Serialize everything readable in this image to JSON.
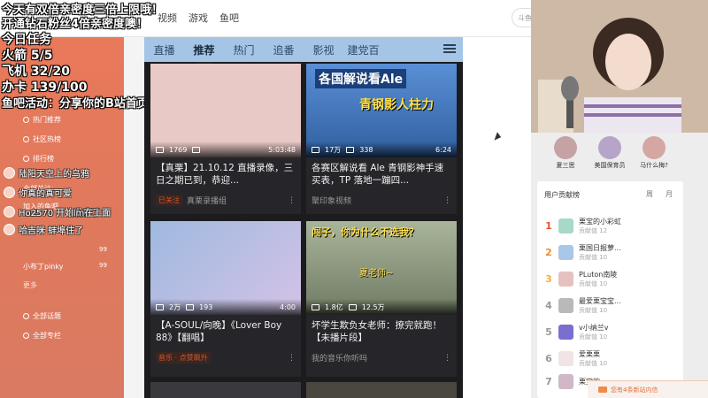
{
  "nav": {
    "items": [
      "视频",
      "游戏",
      "鱼吧"
    ],
    "search_placeholder": "斗鱼"
  },
  "sidebar": {
    "items": [
      {
        "label": "热门推荐"
      },
      {
        "label": "社区热榜"
      },
      {
        "label": "排行榜"
      },
      {
        "label": "全部关注"
      },
      {
        "label": "加入的鱼吧"
      },
      {
        "label": "小布丁pinky",
        "count": "99"
      },
      {
        "label": "更多"
      },
      {
        "label": "全部话题"
      },
      {
        "label": "全部专栏"
      }
    ],
    "counts": [
      "99"
    ]
  },
  "overlay": {
    "line1": "今天有双倍亲密度三倍上限哦！",
    "line2": "开通钻石粉丝4倍亲密度噢！",
    "task_title": "今日任务",
    "task1": "火箭 5/5",
    "task2": "飞机 32/20",
    "task3": "办卡 139/100",
    "task4": "鱼吧活动：分享你的B站首页"
  },
  "danmaku": [
    {
      "text": "陆阳天空上的乌鸦"
    },
    {
      "text": "你真的真可爱"
    },
    {
      "text": "Ho2570 开始发病了"
    },
    {
      "text": "llm在上面"
    },
    {
      "text": "哈吉咪 蚌埠住了"
    }
  ],
  "phone": {
    "tabs": [
      "直播",
      "推荐",
      "热门",
      "追番",
      "影视",
      "建党百"
    ],
    "active_tab": "推荐",
    "cards": [
      {
        "views": "1769",
        "comments": "",
        "duration": "5:03:48",
        "title": "【真栗】21.10.12 直播录像，三日之期已到，恭迎...",
        "tag": "已关注",
        "meta": "真栗录播组",
        "thumb_color": "#e9c9c6"
      },
      {
        "views": "17万",
        "comments": "338",
        "duration": "6:24",
        "title": "各赛区解说看 Ale 青钢影神手速买表，TP 落地一蹦四...",
        "tag": "",
        "meta": "聚印象视频",
        "thumb_color": "#4a7fc6",
        "thumb_text1": "各国解说看Ale",
        "thumb_text2": "青钢影人柱力"
      },
      {
        "views": "2万",
        "comments": "193",
        "duration": "4:00",
        "title": "【A-SOUL/向晚】《Lover Boy 88》【翻唱】",
        "tag": "音乐 · 点赞飙升",
        "meta": "",
        "thumb_color": "#8aa7d4"
      },
      {
        "views": "1.8亿",
        "comments": "12.5万",
        "duration": "",
        "title": "坏学生欺负女老师：撩完就跑！【未播片段】",
        "tag": "",
        "meta": "我的音乐你听吗",
        "thumb_color": "#8c9a7c",
        "thumb_text1": "闯子，你为什么不选我？",
        "thumb_text2": "夏老师~"
      }
    ]
  },
  "right_panel": {
    "top_users": [
      "夏三思",
      "美国保育员",
      "马什么梅?"
    ],
    "contrib_title": "用户贡献榜",
    "contrib_tabs": [
      "周",
      "月"
    ],
    "contrib_rows": [
      {
        "rank": "1",
        "name": "栗宝的小彩虹",
        "sub": "贡献值 12",
        "rank_color": "#e8542e"
      },
      {
        "rank": "2",
        "name": "栗国日报萝...",
        "sub": "贡献值 10",
        "rank_color": "#f08a2e"
      },
      {
        "rank": "3",
        "name": "PLuton南陵",
        "sub": "贡献值 10",
        "rank_color": "#f4b03c"
      },
      {
        "rank": "4",
        "name": "最爱栗宝宝...",
        "sub": "贡献值 10",
        "rank_color": "#999999"
      },
      {
        "rank": "5",
        "name": "v小纳兰v",
        "sub": "贡献值 10",
        "rank_color": "#999999"
      },
      {
        "rank": "6",
        "name": "爱栗栗",
        "sub": "贡献值 10",
        "rank_color": "#999999"
      },
      {
        "rank": "7",
        "name": "栗宝的...",
        "sub": "贡献值 10",
        "rank_color": "#999999"
      }
    ],
    "message": "您有4条新站内信"
  },
  "colors": {
    "accent": "#e0795c",
    "phone_tab_bg": "#a4c5e6"
  }
}
